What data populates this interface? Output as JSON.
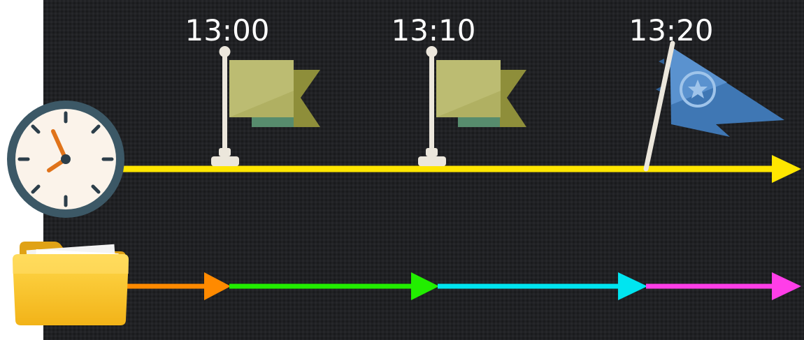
{
  "timeline": {
    "labels": [
      "13:00",
      "13:10",
      "13:20"
    ],
    "axis_color": "#ffe600"
  },
  "flags": [
    {
      "type": "plain-flag",
      "color": "#a8a854",
      "time": "13:00"
    },
    {
      "type": "plain-flag",
      "color": "#a8a854",
      "time": "13:10"
    },
    {
      "type": "pennant-flag-star",
      "color": "#4f86c0",
      "time": "13:20"
    }
  ],
  "icons": {
    "clock": "clock-icon",
    "folder": "folder-icon"
  },
  "segments": {
    "colors": [
      "#ff8a00",
      "#22ee00",
      "#00e5f0",
      "#ff3ee8"
    ]
  },
  "background": "#1e1f21"
}
